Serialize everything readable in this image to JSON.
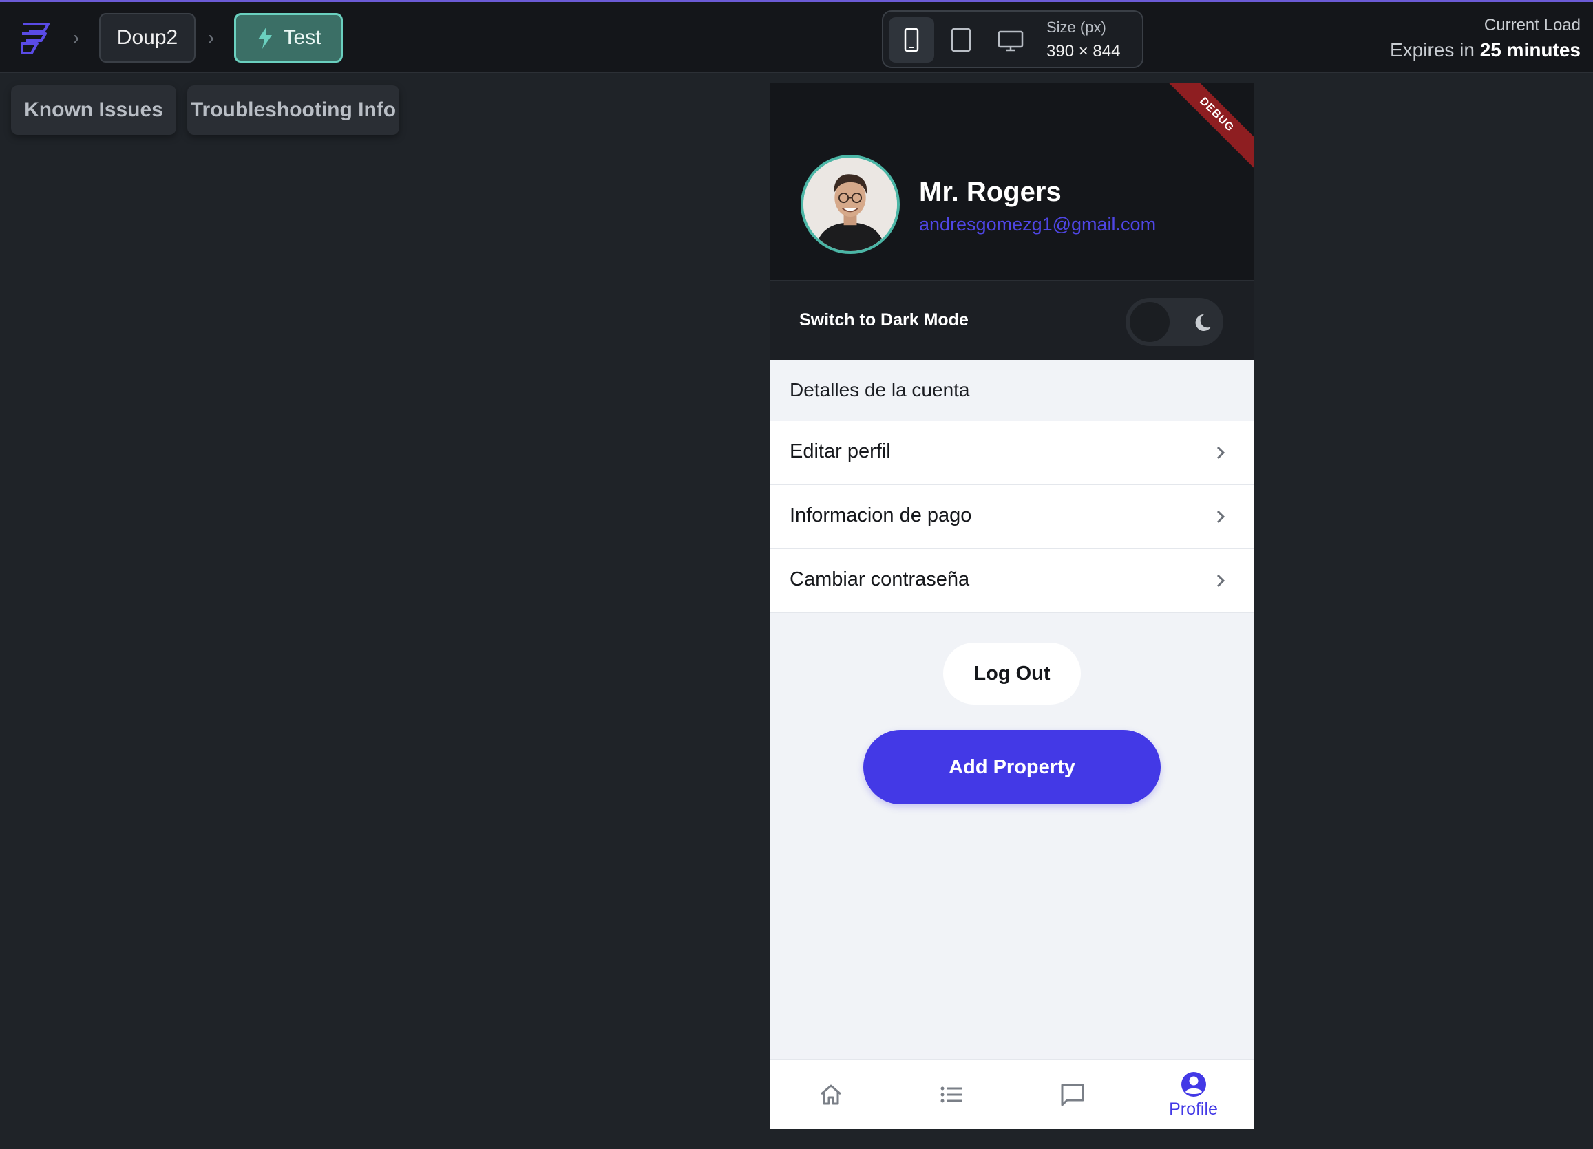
{
  "topbar": {
    "project_name": "Doup2",
    "test_label": "Test",
    "size_label": "Size (px)",
    "size_value": "390 × 844",
    "load_label": "Current Load",
    "expires_prefix": "Expires in",
    "expires_value": "25 minutes",
    "devices": [
      "phone-icon",
      "tablet-icon",
      "desktop-icon"
    ],
    "active_device": "phone"
  },
  "left_pills": {
    "known_issues": "Known Issues",
    "troubleshooting": "Troubleshooting Info"
  },
  "phone": {
    "debug_ribbon": "DEBUG",
    "user": {
      "name": "Mr. Rogers",
      "email": "andresgomezg1@gmail.com"
    },
    "dark_mode": {
      "label": "Switch to Dark Mode",
      "enabled": false
    },
    "account_section_title": "Detalles de la cuenta",
    "account_items": [
      {
        "label": "Editar perfil"
      },
      {
        "label": "Informacion de pago"
      },
      {
        "label": "Cambiar contraseña"
      }
    ],
    "logout_label": "Log Out",
    "add_property_label": "Add Property",
    "bottom_nav": {
      "items": [
        {
          "icon": "home-icon",
          "label": ""
        },
        {
          "icon": "list-icon",
          "label": ""
        },
        {
          "icon": "chat-icon",
          "label": ""
        },
        {
          "icon": "profile-icon",
          "label": "Profile"
        }
      ],
      "active_index": 3
    }
  },
  "colors": {
    "accent": "#4339e6",
    "test_button": "#3b6f66",
    "debug": "#8e1e21",
    "email": "#4f46e5"
  }
}
